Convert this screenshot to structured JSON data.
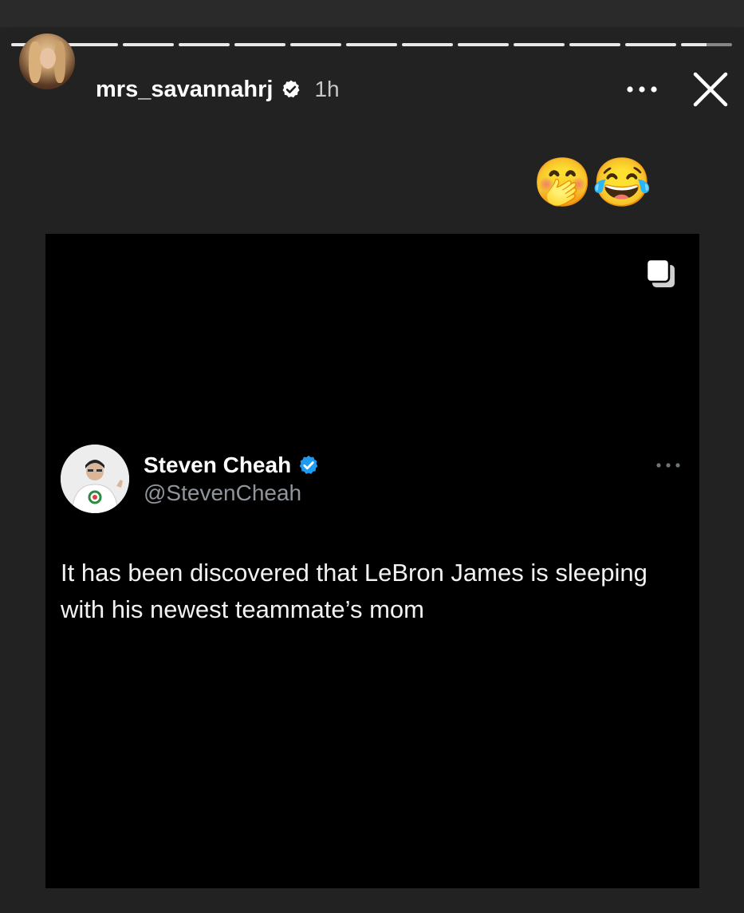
{
  "story": {
    "progress_segments": 13,
    "progress_filled": 12.5,
    "username": "mrs_savannahrj",
    "time_ago": "1h",
    "reaction_emojis": "🤭😂",
    "more_icon": "ellipsis-horizontal-icon",
    "close_icon": "close-x-icon"
  },
  "tweet": {
    "display_name": "Steven Cheah",
    "handle": "@StevenCheah",
    "text": "It has been discovered that LeBron James is sleeping with his newest teammate’s mom",
    "verified_color": "#1d9bf0"
  },
  "colors": {
    "background": "#222222",
    "post_background": "#000000"
  }
}
